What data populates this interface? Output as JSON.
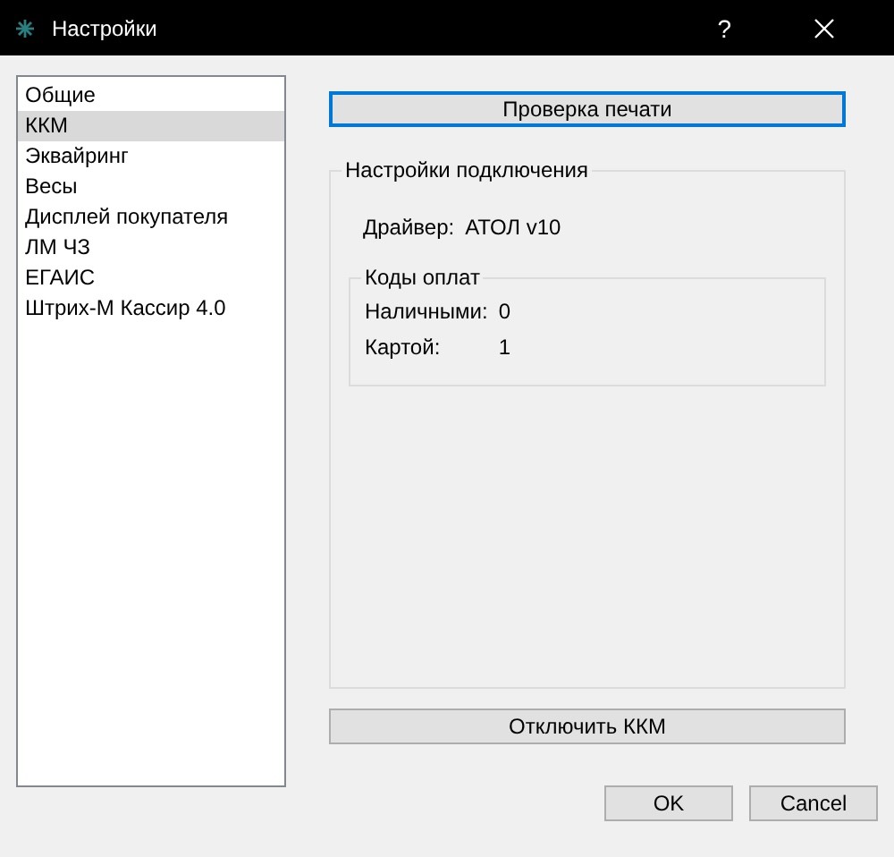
{
  "window": {
    "title": "Настройки",
    "help": "?"
  },
  "sidebar": {
    "items": [
      {
        "label": "Общие",
        "selected": false
      },
      {
        "label": "ККМ",
        "selected": true
      },
      {
        "label": "Эквайринг",
        "selected": false
      },
      {
        "label": "Весы",
        "selected": false
      },
      {
        "label": "Дисплей покупателя",
        "selected": false
      },
      {
        "label": "ЛМ ЧЗ",
        "selected": false
      },
      {
        "label": "ЕГАИС",
        "selected": false
      },
      {
        "label": "Штрих-М Кассир 4.0",
        "selected": false
      }
    ]
  },
  "test_button": {
    "label": "Проверка печати",
    "focused": true
  },
  "connection": {
    "title": "Настройки подключения",
    "driver_label": "Драйвер:",
    "driver_value": "АТОЛ v10",
    "payment_codes": {
      "title": "Коды оплат",
      "rows": [
        {
          "label": "Наличными:",
          "value": "0"
        },
        {
          "label": "Картой:",
          "value": "1"
        }
      ]
    }
  },
  "disconnect_button": {
    "label": "Отключить ККМ",
    "focused": false
  },
  "footer_buttons": [
    "OK",
    "Cancel"
  ]
}
